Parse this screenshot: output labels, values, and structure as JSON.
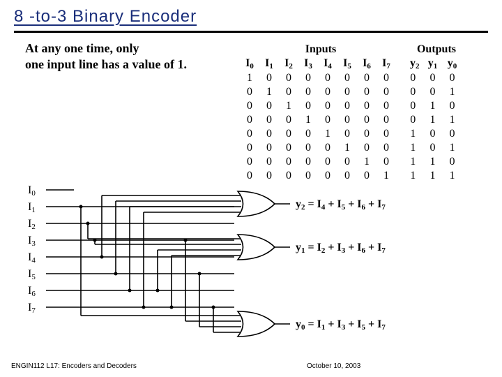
{
  "title": "8 -to-3  Binary Encoder",
  "description_line1": "At any one time, only",
  "description_line2": "one input line has a value of  1.",
  "table": {
    "header_inputs": "Inputs",
    "header_outputs": "Outputs",
    "input_cols": [
      "I 0",
      "I 1",
      "I 2",
      "I 3",
      "I 4",
      "I 5",
      "I 6",
      "I 7"
    ],
    "output_cols": [
      "y 2",
      "y 1",
      "y 0"
    ],
    "rows": [
      {
        "in": [
          "1",
          "0",
          "0",
          "0",
          "0",
          "0",
          "0",
          "0"
        ],
        "out": [
          "0",
          "0",
          "0"
        ]
      },
      {
        "in": [
          "0",
          "1",
          "0",
          "0",
          "0",
          "0",
          "0",
          "0"
        ],
        "out": [
          "0",
          "0",
          "1"
        ]
      },
      {
        "in": [
          "0",
          "0",
          "1",
          "0",
          "0",
          "0",
          "0",
          "0"
        ],
        "out": [
          "0",
          "1",
          "0"
        ]
      },
      {
        "in": [
          "0",
          "0",
          "0",
          "1",
          "0",
          "0",
          "0",
          "0"
        ],
        "out": [
          "0",
          "1",
          "1"
        ]
      },
      {
        "in": [
          "0",
          "0",
          "0",
          "0",
          "1",
          "0",
          "0",
          "0"
        ],
        "out": [
          "1",
          "0",
          "0"
        ]
      },
      {
        "in": [
          "0",
          "0",
          "0",
          "0",
          "0",
          "1",
          "0",
          "0"
        ],
        "out": [
          "1",
          "0",
          "1"
        ]
      },
      {
        "in": [
          "0",
          "0",
          "0",
          "0",
          "0",
          "0",
          "1",
          "0"
        ],
        "out": [
          "1",
          "1",
          "0"
        ]
      },
      {
        "in": [
          "0",
          "0",
          "0",
          "0",
          "0",
          "0",
          "0",
          "1"
        ],
        "out": [
          "1",
          "1",
          "1"
        ]
      }
    ]
  },
  "circuit": {
    "input_labels": [
      "I0",
      "I1",
      "I2",
      "I3",
      "I4",
      "I5",
      "I6",
      "I7"
    ],
    "equations": {
      "y2": "y2 = I4 + I5 + I6 + I7",
      "y1": "y1 = I2 + I3 + I6 + I7",
      "y0": "y0 = I1 + I3 + I5 + I7"
    }
  },
  "footer": {
    "left": "ENGIN112 L17: Encoders and Decoders",
    "right": "October 10, 2003"
  },
  "chart_data": {
    "type": "table",
    "title": "8-to-3 Binary Encoder Truth Table",
    "columns": [
      "I0",
      "I1",
      "I2",
      "I3",
      "I4",
      "I5",
      "I6",
      "I7",
      "y2",
      "y1",
      "y0"
    ],
    "rows": [
      [
        1,
        0,
        0,
        0,
        0,
        0,
        0,
        0,
        0,
        0,
        0
      ],
      [
        0,
        1,
        0,
        0,
        0,
        0,
        0,
        0,
        0,
        0,
        1
      ],
      [
        0,
        0,
        1,
        0,
        0,
        0,
        0,
        0,
        0,
        1,
        0
      ],
      [
        0,
        0,
        0,
        1,
        0,
        0,
        0,
        0,
        0,
        1,
        1
      ],
      [
        0,
        0,
        0,
        0,
        1,
        0,
        0,
        0,
        1,
        0,
        0
      ],
      [
        0,
        0,
        0,
        0,
        0,
        1,
        0,
        0,
        1,
        0,
        1
      ],
      [
        0,
        0,
        0,
        0,
        0,
        0,
        1,
        0,
        1,
        1,
        0
      ],
      [
        0,
        0,
        0,
        0,
        0,
        0,
        0,
        1,
        1,
        1,
        1
      ]
    ]
  }
}
